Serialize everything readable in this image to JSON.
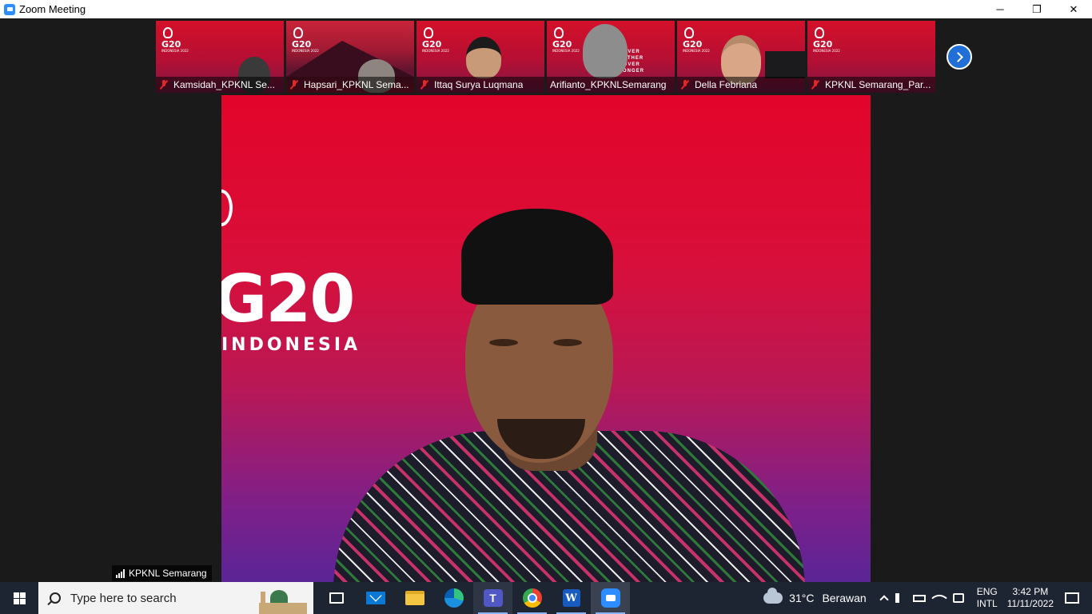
{
  "window": {
    "title": "Zoom Meeting",
    "minimize": "─",
    "restore": "❐",
    "close": "✕"
  },
  "gallery": {
    "participants": [
      {
        "name": "Kamsidah_KPKNL Se...",
        "muted": true
      },
      {
        "name": "Hapsari_KPKNL Sema...",
        "muted": true
      },
      {
        "name": "Ittaq Surya Luqmana",
        "muted": true
      },
      {
        "name": "Arifianto_KPKNLSemarang",
        "muted": false
      },
      {
        "name": "Della Febriana",
        "muted": true
      },
      {
        "name": "KPKNL Semarang_Par...",
        "muted": true
      }
    ],
    "logo_text": "G20",
    "logo_sub": "INDONESIA 2022",
    "slogan": "RECOVER TOGETHER RECOVER STRONGER"
  },
  "speaker": {
    "name": "KPKNL Semarang",
    "background_logo": "G20",
    "background_sub": "INDONESIA"
  },
  "taskbar": {
    "search_placeholder": "Type here to search",
    "teams_letter": "T",
    "word_letter": "W",
    "weather_temp": "31°C",
    "weather_desc": "Berawan",
    "lang_top": "ENG",
    "lang_bottom": "INTL",
    "time": "3:42 PM",
    "date": "11/11/2022"
  },
  "colors": {
    "zoom_blue": "#2d8cff",
    "g20_red": "#e3042a",
    "mic_off_red": "#e02828",
    "taskbar_bg": "#1d2533"
  }
}
